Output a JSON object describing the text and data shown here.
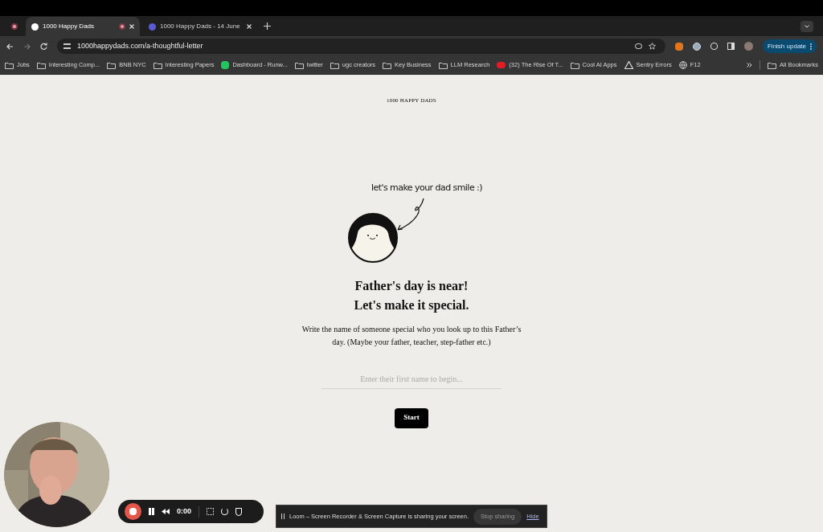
{
  "tabs": [
    {
      "title": "1000 Happy Dads",
      "selected": true,
      "recording": true
    },
    {
      "title": "1000 Happy Dads - 14 June",
      "selected": false,
      "recording": false
    }
  ],
  "address": "1000happydads.com/a-thoughtful-letter",
  "update_button": "Finish update",
  "bookmarks": [
    {
      "kind": "folder",
      "label": "Jobs"
    },
    {
      "kind": "folder",
      "label": "Interesting Comp..."
    },
    {
      "kind": "folder",
      "label": "BNB NYC"
    },
    {
      "kind": "folder",
      "label": "Interesting Papers"
    },
    {
      "kind": "app",
      "label": "Dashboard - Runw..."
    },
    {
      "kind": "folder",
      "label": "twitter"
    },
    {
      "kind": "folder",
      "label": "ugc creators"
    },
    {
      "kind": "folder",
      "label": "Key Business"
    },
    {
      "kind": "folder",
      "label": "LLM Research"
    },
    {
      "kind": "video",
      "label": "(32) The Rise Of T..."
    },
    {
      "kind": "folder",
      "label": "Cool AI Apps"
    },
    {
      "kind": "warning",
      "label": "Sentry Errors"
    },
    {
      "kind": "globe",
      "label": "F12"
    }
  ],
  "all_bookmarks": "All Bookmarks",
  "page": {
    "brand": "1000 HAPPY DADS",
    "speech": "let's make your dad smile :)",
    "heading": [
      "Father's day is near!",
      "Let's make it special."
    ],
    "description": "Write the name of someone special who you look up to this Father’s day. (Maybe your father, teacher, step-father etc.)",
    "name_field": {
      "placeholder": "Enter their first name to begin..."
    },
    "start_button": "Start"
  },
  "recorder": {
    "time": "0:00"
  },
  "share_bar": {
    "message": "Loom – Screen Recorder & Screen Capture is sharing your screen.",
    "stop_button": "Stop sharing",
    "hide_link": "Hide"
  }
}
